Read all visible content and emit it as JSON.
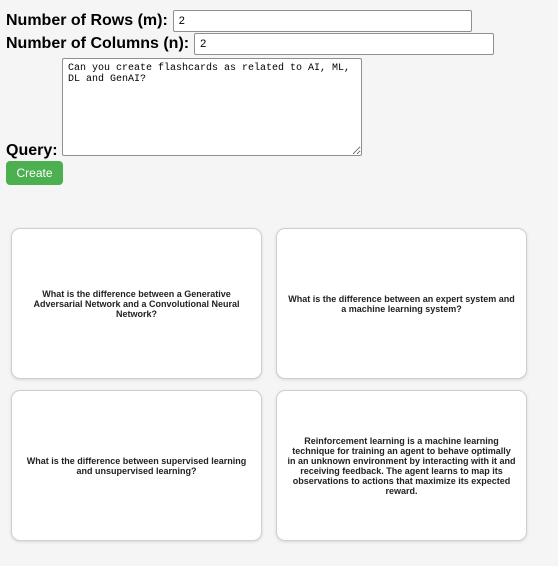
{
  "form": {
    "rows_label": "Number of Rows (m):",
    "rows_value": "2",
    "cols_label": "Number of Columns (n):",
    "cols_value": "2",
    "query_label": "Query:",
    "query_value": "Can you create flashcards as related to AI, ML,\nDL and GenAI?",
    "create_label": "Create"
  },
  "cards": [
    {
      "text": "What is the difference between a Generative Adversarial Network and a Convolutional Neural Network?"
    },
    {
      "text": "What is the difference between an expert system and a machine learning system?"
    },
    {
      "text": "What is the difference between supervised learning and unsupervised learning?"
    },
    {
      "text": "Reinforcement learning is a machine learning technique for training an agent to behave optimally in an unknown environment by interacting with it and receiving feedback. The agent learns to map its observations to actions that maximize its expected reward."
    }
  ],
  "colors": {
    "button": "#4caf50",
    "background": "#f5f5f5"
  }
}
